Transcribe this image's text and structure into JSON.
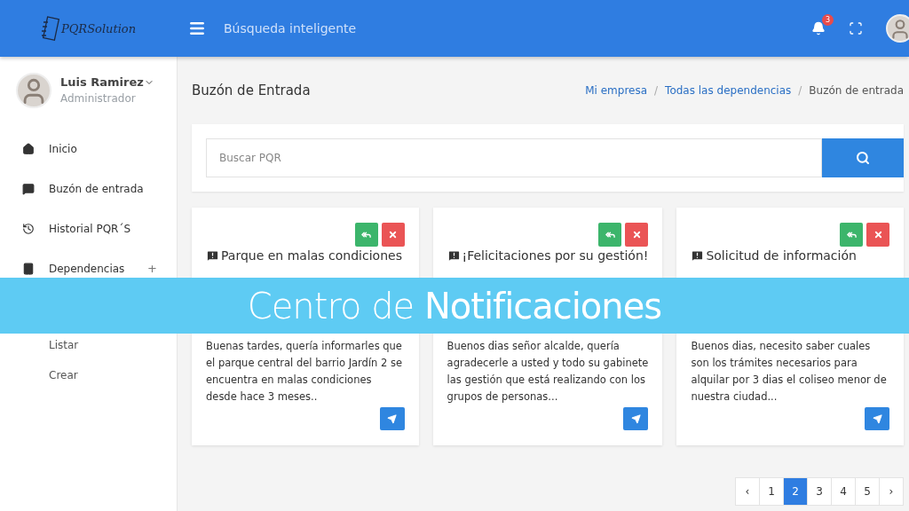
{
  "header": {
    "logo": "PQRSolution",
    "search_label": "Búsqueda inteligente",
    "notification_count": "3"
  },
  "user": {
    "name": "Luis Ramirez",
    "role": "Administrador"
  },
  "sidebar": {
    "items": [
      {
        "label": "Inicio"
      },
      {
        "label": "Buzón de entrada"
      },
      {
        "label": "Historial PQR´S"
      },
      {
        "label": "Dependencias",
        "toggle": "+"
      }
    ],
    "subitems": [
      {
        "label": "Listar"
      },
      {
        "label": "Crear"
      }
    ]
  },
  "page_title": "Buzón de Entrada",
  "breadcrumb": [
    {
      "label": "Mi empresa",
      "link": true
    },
    {
      "label": "Todas las dependencias",
      "link": true
    },
    {
      "label": "Buzón de entrada",
      "link": false
    }
  ],
  "breadcrumb_separator": "/",
  "search": {
    "placeholder": "Buscar PQR"
  },
  "cards": [
    {
      "title": "Parque en malas condiciones",
      "body": "Buenas tardes, quería informarles que el parque central del barrio Jardín 2 se encuentra en malas condiciones desde hace 3 meses.."
    },
    {
      "title": "¡Felicitaciones por su gestión!",
      "body": "Buenos dias señor alcalde, quería agradecerle a usted y todo su gabinete las gestión que está realizando con los grupos de personas..."
    },
    {
      "title": "Solicitud de información",
      "body": "Buenos dias, necesito saber cuales son los trámites necesarios para alquilar por 3 dias el coliseo menor de nuestra ciudad..."
    }
  ],
  "pagination": {
    "prev": "‹",
    "pages": [
      {
        "label": "1",
        "selected": false
      },
      {
        "label": "2",
        "selected": true
      },
      {
        "label": "3",
        "selected": false
      },
      {
        "label": "4",
        "selected": false
      },
      {
        "label": "5",
        "selected": false
      }
    ],
    "next": "›"
  },
  "banner": "Centro de **Notificaciones**"
}
